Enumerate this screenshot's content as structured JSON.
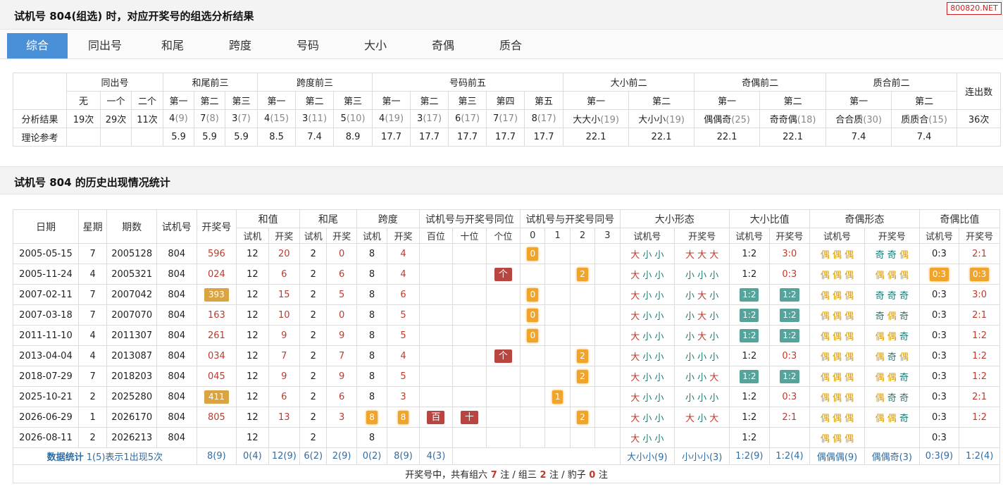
{
  "header": {
    "title": "试机号 804(组选) 时，对应开奖号的组选分析结果",
    "site_badge": "800820.NET"
  },
  "tabs": [
    "综合",
    "同出号",
    "和尾",
    "跨度",
    "号码",
    "大小",
    "奇偶",
    "质合"
  ],
  "summary": {
    "groups": [
      "同出号",
      "和尾前三",
      "跨度前三",
      "号码前五",
      "大小前二",
      "奇偶前二",
      "质合前二",
      "连出数"
    ],
    "subheaders": [
      "无",
      "一个",
      "二个",
      "第一",
      "第二",
      "第三",
      "第一",
      "第二",
      "第三",
      "第一",
      "第二",
      "第三",
      "第四",
      "第五",
      "第一",
      "第二",
      "第一",
      "第二",
      "第一",
      "第二"
    ],
    "result_label": "分析结果",
    "reference_label": "理论参考",
    "results": [
      {
        "v": "19次",
        "n": ""
      },
      {
        "v": "29次",
        "n": ""
      },
      {
        "v": "11次",
        "n": ""
      },
      {
        "v": "4",
        "n": "(9)"
      },
      {
        "v": "7",
        "n": "(8)"
      },
      {
        "v": "3",
        "n": "(7)"
      },
      {
        "v": "4",
        "n": "(15)"
      },
      {
        "v": "3",
        "n": "(11)"
      },
      {
        "v": "5",
        "n": "(10)"
      },
      {
        "v": "4",
        "n": "(19)"
      },
      {
        "v": "3",
        "n": "(17)"
      },
      {
        "v": "6",
        "n": "(17)"
      },
      {
        "v": "7",
        "n": "(17)"
      },
      {
        "v": "8",
        "n": "(17)"
      },
      {
        "v": "大大小",
        "n": "(19)"
      },
      {
        "v": "大小小",
        "n": "(19)"
      },
      {
        "v": "偶偶奇",
        "n": "(25)"
      },
      {
        "v": "奇奇偶",
        "n": "(18)"
      },
      {
        "v": "合合质",
        "n": "(30)"
      },
      {
        "v": "质质合",
        "n": "(15)"
      },
      {
        "v": "36次",
        "n": ""
      }
    ],
    "reference": [
      "",
      "",
      "",
      "5.9",
      "5.9",
      "5.9",
      "8.5",
      "7.4",
      "8.9",
      "17.7",
      "17.7",
      "17.7",
      "17.7",
      "17.7",
      "22.1",
      "22.1",
      "22.1",
      "22.1",
      "7.4",
      "7.4",
      ""
    ]
  },
  "history": {
    "title": "试机号 804 的历史出现情况统计",
    "head1": [
      "日期",
      "星期",
      "期数",
      "试机号",
      "开奖号",
      "和值",
      "和尾",
      "跨度",
      "试机号与开奖号同位",
      "试机号与开奖号同号",
      "大小形态",
      "大小比值",
      "奇偶形态",
      "奇偶比值"
    ],
    "head2": [
      "试机",
      "开奖",
      "试机",
      "开奖",
      "试机",
      "开奖",
      "百位",
      "十位",
      "个位",
      "0",
      "1",
      "2",
      "3",
      "试机号",
      "开奖号",
      "试机号",
      "开奖号",
      "试机号",
      "开奖号",
      "试机号",
      "开奖号"
    ],
    "rows": [
      {
        "date": "2005-05-15",
        "week": "7",
        "issue": "2005128",
        "test": "804",
        "draw": "596",
        "draw_hl": false,
        "sum_t": "12",
        "sum_d": "20",
        "tail_t": "2",
        "tail_d": "0",
        "span_t": "8",
        "span_d": "4",
        "span_hl": false,
        "pos": [
          "",
          "",
          ""
        ],
        "same": [
          "0",
          "",
          "",
          ""
        ],
        "bs_t": "大小小",
        "bs_d": "大大大",
        "bsr_t": "1:2",
        "bsr_d": "3:0",
        "bsr_hl": false,
        "oe_t": "偶偶偶",
        "oe_d": "奇奇偶",
        "oer_t": "0:3",
        "oer_d": "2:1",
        "oer_hl": false
      },
      {
        "date": "2005-11-24",
        "week": "4",
        "issue": "2005321",
        "test": "804",
        "draw": "024",
        "draw_hl": false,
        "sum_t": "12",
        "sum_d": "6",
        "tail_t": "2",
        "tail_d": "6",
        "span_t": "8",
        "span_d": "4",
        "span_hl": false,
        "pos": [
          "",
          "",
          "个"
        ],
        "same": [
          "",
          "",
          "2",
          ""
        ],
        "bs_t": "大小小",
        "bs_d": "小小小",
        "bsr_t": "1:2",
        "bsr_d": "0:3",
        "bsr_hl": false,
        "oe_t": "偶偶偶",
        "oe_d": "偶偶偶",
        "oer_t": "0:3",
        "oer_d": "0:3",
        "oer_hl": true
      },
      {
        "date": "2007-02-11",
        "week": "7",
        "issue": "2007042",
        "test": "804",
        "draw": "393",
        "draw_hl": true,
        "sum_t": "12",
        "sum_d": "15",
        "tail_t": "2",
        "tail_d": "5",
        "span_t": "8",
        "span_d": "6",
        "span_hl": false,
        "pos": [
          "",
          "",
          ""
        ],
        "same": [
          "0",
          "",
          "",
          ""
        ],
        "bs_t": "大小小",
        "bs_d": "小大小",
        "bsr_t": "1:2",
        "bsr_d": "1:2",
        "bsr_hl": true,
        "oe_t": "偶偶偶",
        "oe_d": "奇奇奇",
        "oer_t": "0:3",
        "oer_d": "3:0",
        "oer_hl": false
      },
      {
        "date": "2007-03-18",
        "week": "7",
        "issue": "2007070",
        "test": "804",
        "draw": "163",
        "draw_hl": false,
        "sum_t": "12",
        "sum_d": "10",
        "tail_t": "2",
        "tail_d": "0",
        "span_t": "8",
        "span_d": "5",
        "span_hl": false,
        "pos": [
          "",
          "",
          ""
        ],
        "same": [
          "0",
          "",
          "",
          ""
        ],
        "bs_t": "大小小",
        "bs_d": "小大小",
        "bsr_t": "1:2",
        "bsr_d": "1:2",
        "bsr_hl": true,
        "oe_t": "偶偶偶",
        "oe_d": "奇偶奇",
        "oer_t": "0:3",
        "oer_d": "2:1",
        "oer_hl": false
      },
      {
        "date": "2011-11-10",
        "week": "4",
        "issue": "2011307",
        "test": "804",
        "draw": "261",
        "draw_hl": false,
        "sum_t": "12",
        "sum_d": "9",
        "tail_t": "2",
        "tail_d": "9",
        "span_t": "8",
        "span_d": "5",
        "span_hl": false,
        "pos": [
          "",
          "",
          ""
        ],
        "same": [
          "0",
          "",
          "",
          ""
        ],
        "bs_t": "大小小",
        "bs_d": "小大小",
        "bsr_t": "1:2",
        "bsr_d": "1:2",
        "bsr_hl": true,
        "oe_t": "偶偶偶",
        "oe_d": "偶偶奇",
        "oer_t": "0:3",
        "oer_d": "1:2",
        "oer_hl": false
      },
      {
        "date": "2013-04-04",
        "week": "4",
        "issue": "2013087",
        "test": "804",
        "draw": "034",
        "draw_hl": false,
        "sum_t": "12",
        "sum_d": "7",
        "tail_t": "2",
        "tail_d": "7",
        "span_t": "8",
        "span_d": "4",
        "span_hl": false,
        "pos": [
          "",
          "",
          "个"
        ],
        "same": [
          "",
          "",
          "2",
          ""
        ],
        "bs_t": "大小小",
        "bs_d": "小小小",
        "bsr_t": "1:2",
        "bsr_d": "0:3",
        "bsr_hl": false,
        "oe_t": "偶偶偶",
        "oe_d": "偶奇偶",
        "oer_t": "0:3",
        "oer_d": "1:2",
        "oer_hl": false
      },
      {
        "date": "2018-07-29",
        "week": "7",
        "issue": "2018203",
        "test": "804",
        "draw": "045",
        "draw_hl": false,
        "sum_t": "12",
        "sum_d": "9",
        "tail_t": "2",
        "tail_d": "9",
        "span_t": "8",
        "span_d": "5",
        "span_hl": false,
        "pos": [
          "",
          "",
          ""
        ],
        "same": [
          "",
          "",
          "2",
          ""
        ],
        "bs_t": "大小小",
        "bs_d": "小小大",
        "bsr_t": "1:2",
        "bsr_d": "1:2",
        "bsr_hl": true,
        "oe_t": "偶偶偶",
        "oe_d": "偶偶奇",
        "oer_t": "0:3",
        "oer_d": "1:2",
        "oer_hl": false
      },
      {
        "date": "2025-10-21",
        "week": "2",
        "issue": "2025280",
        "test": "804",
        "draw": "411",
        "draw_hl": true,
        "sum_t": "12",
        "sum_d": "6",
        "tail_t": "2",
        "tail_d": "6",
        "span_t": "8",
        "span_d": "3",
        "span_hl": false,
        "pos": [
          "",
          "",
          ""
        ],
        "same": [
          "",
          "1",
          "",
          ""
        ],
        "bs_t": "大小小",
        "bs_d": "小小小",
        "bsr_t": "1:2",
        "bsr_d": "0:3",
        "bsr_hl": false,
        "oe_t": "偶偶偶",
        "oe_d": "偶奇奇",
        "oer_t": "0:3",
        "oer_d": "2:1",
        "oer_hl": false
      },
      {
        "date": "2026-06-29",
        "week": "1",
        "issue": "2026170",
        "test": "804",
        "draw": "805",
        "draw_hl": false,
        "sum_t": "12",
        "sum_d": "13",
        "tail_t": "2",
        "tail_d": "3",
        "span_t": "8",
        "span_d": "8",
        "span_hl": true,
        "pos": [
          "百",
          "十",
          ""
        ],
        "same": [
          "",
          "",
          "2",
          ""
        ],
        "bs_t": "大小小",
        "bs_d": "大小大",
        "bsr_t": "1:2",
        "bsr_d": "2:1",
        "bsr_hl": false,
        "oe_t": "偶偶偶",
        "oe_d": "偶偶奇",
        "oer_t": "0:3",
        "oer_d": "1:2",
        "oer_hl": false
      },
      {
        "date": "2026-08-11",
        "week": "2",
        "issue": "2026213",
        "test": "804",
        "draw": "",
        "draw_hl": false,
        "sum_t": "12",
        "sum_d": "",
        "tail_t": "2",
        "tail_d": "",
        "span_t": "8",
        "span_d": "",
        "span_hl": false,
        "pos": [
          "",
          "",
          ""
        ],
        "same": [
          "",
          "",
          "",
          ""
        ],
        "bs_t": "大小小",
        "bs_d": "",
        "bsr_t": "1:2",
        "bsr_d": "",
        "bsr_hl": false,
        "oe_t": "偶偶偶",
        "oe_d": "",
        "oer_t": "0:3",
        "oer_d": "",
        "oer_hl": false
      }
    ],
    "stats": {
      "label": "数据统计",
      "note": "1(5)表示1出现5次",
      "draw": "8(9)",
      "sum_t": "0(4)",
      "sum_d": "12(9)",
      "tail_t": "6(2)",
      "tail_d": "2(9)",
      "span_t": "0(2)",
      "span_d": "8(9)",
      "same": "4(3)",
      "bs_t": "大小小(9)",
      "bs_d": "小小小(3)",
      "bsr_t": "1:2(9)",
      "bsr_d": "1:2(4)",
      "oe_t": "偶偶偶(9)",
      "oe_d": "偶偶奇(3)",
      "oer_t": "0:3(9)",
      "oer_d": "1:2(4)"
    },
    "footer": {
      "prefix": "开奖号中，共有组六",
      "g6": "7",
      "mid1": "注 / 组三",
      "g3": "2",
      "mid2": "注 / 豹子",
      "bz": "0",
      "suffix": "注"
    }
  },
  "colors": {
    "tab_active": "#4a90d9",
    "red_text": "#c0392b",
    "orange_tag": "#f0a52a",
    "maroon_tag": "#b8453f",
    "green_tag": "#55a39a",
    "gold_tag": "#d9a441"
  }
}
